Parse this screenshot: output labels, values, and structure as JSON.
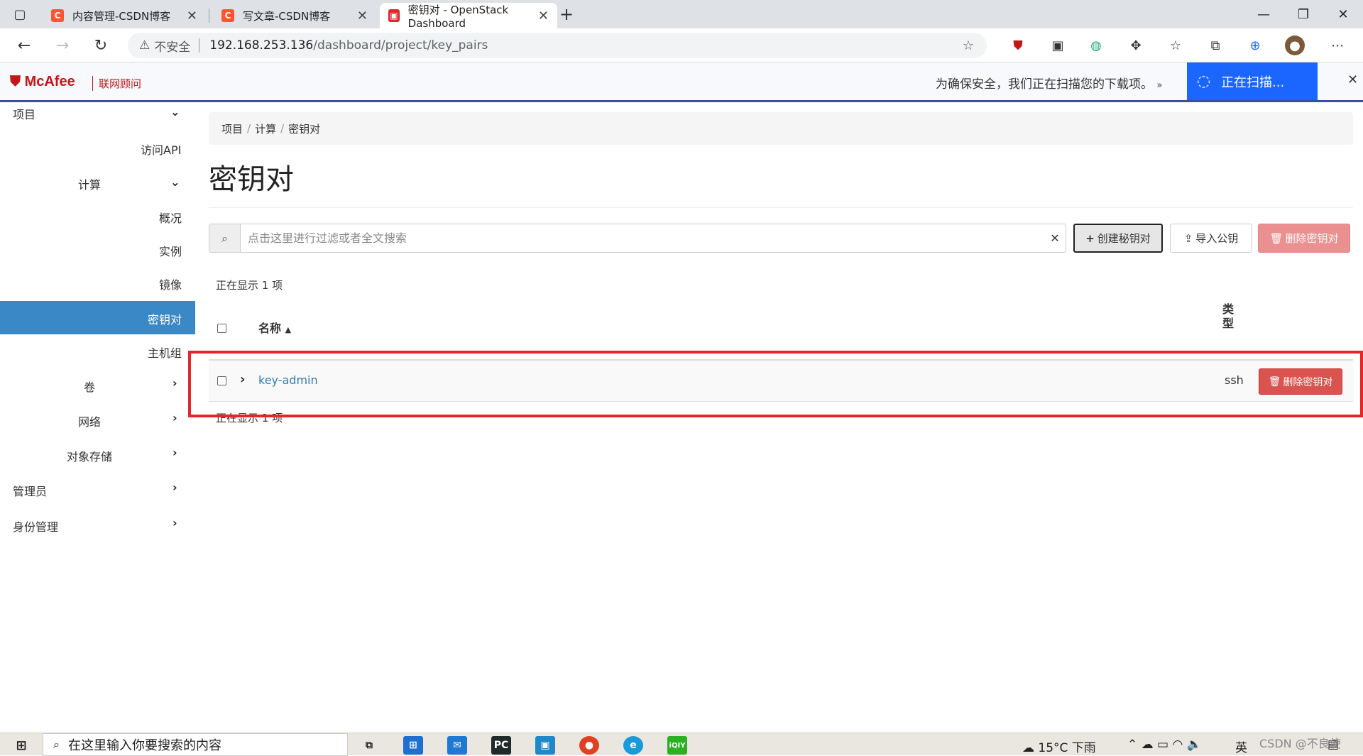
{
  "browser": {
    "tabs": [
      {
        "title": "内容管理-CSDN博客",
        "icon": "csdn-logo"
      },
      {
        "title": "写文章-CSDN博客",
        "icon": "csdn-logo"
      },
      {
        "title": "密钥对 - OpenStack Dashboard",
        "icon": "openstack-logo"
      }
    ],
    "address": {
      "security_label": "不安全",
      "host": "192.168.253.136",
      "path": "/dashboard/project/key_pairs"
    }
  },
  "mcafee": {
    "brand": "McAfee",
    "sub": "联网顾问",
    "message": "为确保安全，我们正在扫描您的下载项。",
    "chevron": "»",
    "scan_button": "正在扫描..."
  },
  "sidebar": {
    "project": "项目",
    "api_access": "访问API",
    "compute": "计算",
    "overview": "概况",
    "instances": "实例",
    "images": "镜像",
    "key_pairs": "密钥对",
    "server_groups": "主机组",
    "volumes": "卷",
    "network": "网络",
    "object_store": "对象存储",
    "admin": "管理员",
    "identity": "身份管理"
  },
  "main": {
    "breadcrumb": [
      "项目",
      "计算",
      "密钥对"
    ],
    "page_title": "密钥对",
    "search_placeholder": "点击这里进行过滤或者全文搜索",
    "create_button": "创建秘钥对",
    "import_button": "导入公钥",
    "delete_button": "删除密钥对",
    "count_top": "正在显示 1 项",
    "count_bottom": "正在显示 1 项",
    "columns": {
      "name": "名称",
      "type": "类型"
    },
    "rows": [
      {
        "name": "key-admin",
        "type": "ssh",
        "action": "删除密钥对"
      }
    ]
  },
  "taskbar": {
    "search_placeholder": "在这里输入你要搜索的内容",
    "weather": "15°C 下雨",
    "ime": "英",
    "watermark": "CSDN @不良使"
  },
  "colors": {
    "accent": "#3b88c6",
    "danger": "#d9534f",
    "highlight": "#e5252a",
    "mcafee_scan": "#1a66ff"
  }
}
